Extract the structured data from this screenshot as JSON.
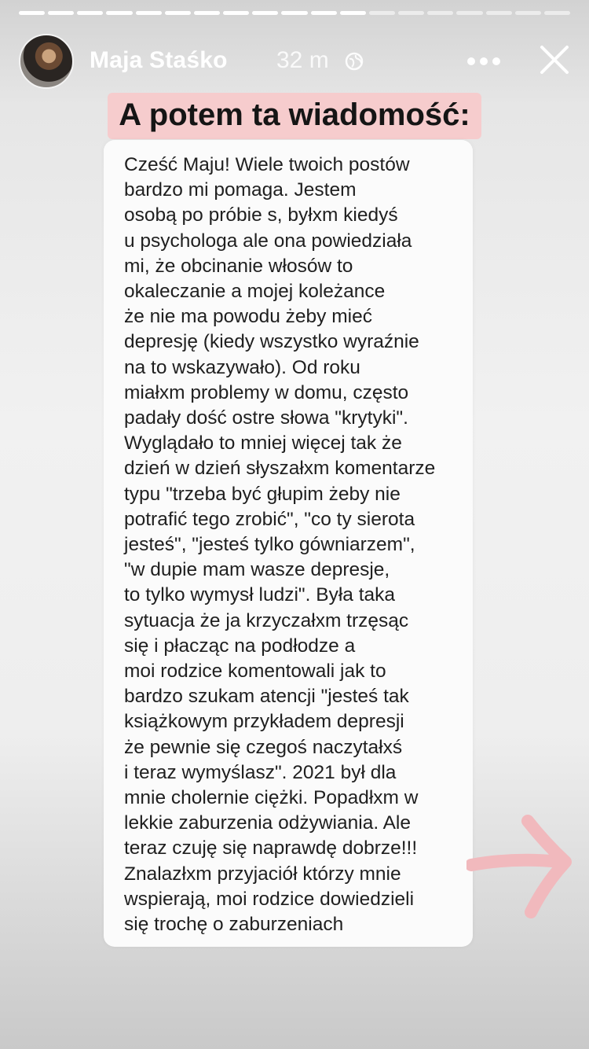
{
  "story": {
    "progress_total": 19,
    "progress_done": 12
  },
  "header": {
    "username": "Maja Staśko",
    "time": "32 m",
    "globe_icon": "globe-icon",
    "more_icon": "more-horizontal-icon",
    "close_icon": "close-icon"
  },
  "headline": "A potem ta wiadomość:",
  "message": {
    "lines": [
      "Cześć Maju! Wiele twoich postów",
      "bardzo mi pomaga. Jestem",
      "osobą po próbie s, byłxm kiedyś",
      "u psychologa ale ona powiedziała",
      "mi, że obcinanie włosów to",
      "okaleczanie a mojej koleżance",
      "że nie ma powodu żeby mieć",
      "depresję (kiedy wszystko wyraźnie",
      "na to wskazywało). Od roku",
      "miałxm problemy w domu, często",
      "padały dość ostre słowa \"krytyki\".",
      "Wyglądało to mniej więcej tak że",
      "dzień w dzień słyszałxm komentarze",
      "typu \"trzeba być głupim żeby nie",
      "potrafić tego zrobić\", \"co ty sierota",
      "jesteś\", \"jesteś tylko gówniarzem\",",
      "\"w dupie mam wasze depresje,",
      "to tylko wymysł ludzi\". Była taka",
      "sytuacja że ja krzyczałxm trzęsąc",
      "się i płacząc na podłodze a",
      "moi rodzice komentowali jak to",
      "bardzo szukam atencji \"jesteś tak",
      "książkowym przykładem depresji",
      "że pewnie się czegoś naczytałxś",
      "i teraz wymyślasz\". 2021 był dla",
      "mnie cholernie ciężki. Popadłxm w",
      "lekkie zaburzenia odżywiania. Ale",
      "teraz czuję się naprawdę dobrze!!!",
      "Znalazłxm przyjaciół którzy mnie",
      "wspierają, moi rodzice dowiedzieli",
      "się trochę o zaburzeniach"
    ]
  },
  "colors": {
    "headline_bg": "#f6cccd",
    "arrow": "#f1b9bd"
  }
}
